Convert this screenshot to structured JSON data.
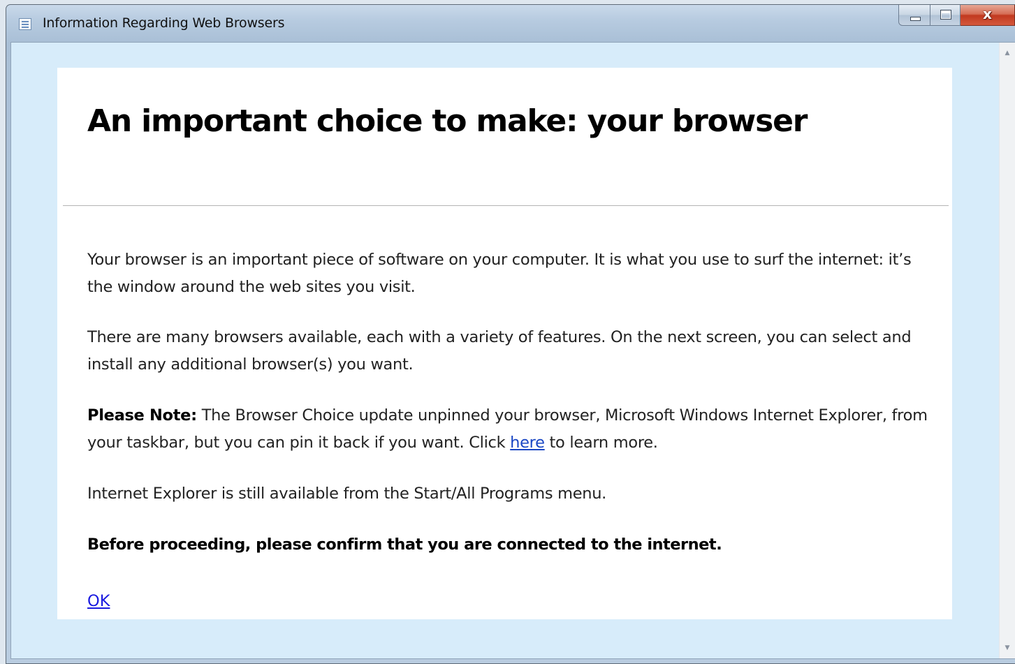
{
  "window": {
    "title": "Information Regarding Web Browsers",
    "close_glyph": "x"
  },
  "content": {
    "heading": "An important choice to make: your browser",
    "para1": "Your browser is an important piece of software on your computer. It is what you use to surf the internet: it’s the window around the web sites you visit.",
    "para2": "There are many browsers available, each with a variety of features. On the next screen, you can select and install any additional browser(s) you want.",
    "para3_bold": "Please Note:",
    "para3_text": " The Browser Choice update unpinned your browser, Microsoft Windows Internet Explorer, from your taskbar, but you can pin it back if you want. Click ",
    "para3_link": "here",
    "para3_tail": " to learn more.",
    "para4": "Internet Explorer is still available from the Start/All Programs menu.",
    "para5": "Before proceeding, please confirm that you are connected to the internet.",
    "ok_link": "OK"
  },
  "colors": {
    "client_background": "#d7ecfa",
    "link": "#1a47c4",
    "ok_link": "#1a1ae0",
    "close_button": "#c1391f"
  },
  "icons": {
    "window_icon": "list-document-icon",
    "minimize": "minimize-icon",
    "maximize": "maximize-icon",
    "close": "close-icon",
    "scroll_up": "scroll-up-arrow-icon",
    "scroll_down": "scroll-down-arrow-icon"
  }
}
